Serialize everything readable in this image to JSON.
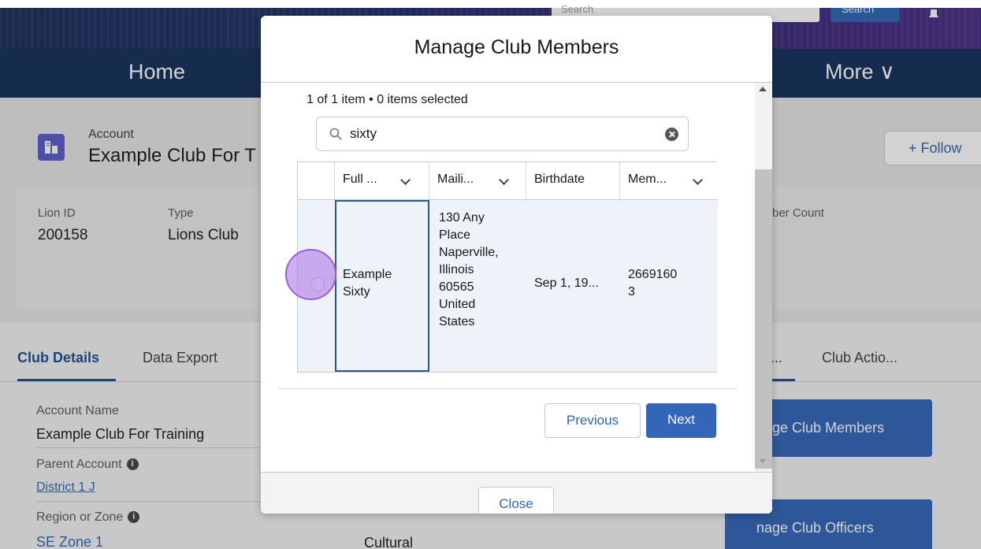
{
  "header": {
    "search_placeholder": "Search",
    "search_button": "Search",
    "nav_home": "Home",
    "nav_more": "More ∨"
  },
  "account": {
    "label": "Account",
    "name": "Example Club For T",
    "follow": "+ Follow",
    "fields": [
      {
        "label": "Lion ID",
        "value": "200158"
      },
      {
        "label": "Type",
        "value": "Lions Club"
      },
      {
        "label": "ber Count",
        "value": ""
      }
    ]
  },
  "tabs": {
    "club_details": "Club Details",
    "data_export": "Data Export",
    "ellipsis": "...",
    "club_actions": "Club Actio..."
  },
  "details": {
    "account_name_label": "Account Name",
    "account_name_value": "Example Club For Training",
    "parent_account_label": "Parent Account",
    "parent_account_value": "District 1 J",
    "region_label": "Region or Zone",
    "region_value": "SE Zone 1",
    "cultural": "Cultural"
  },
  "actions": {
    "manage_members": "nage Club Members",
    "manage_officers": "nage Club Officers"
  },
  "modal": {
    "title": "Manage Club Members",
    "items_count": "1 of 1 item • 0 items selected",
    "search_value": "sixty",
    "columns": [
      "Full ...",
      "Maili...",
      "Birthdate",
      "Mem..."
    ],
    "row": {
      "full_name": "Example Sixty",
      "mailing": [
        "130 Any",
        "Place",
        "Naperville,",
        "Illinois",
        "60565",
        "United",
        "States"
      ],
      "birthdate": "Sep 1, 19...",
      "member_id": [
        "2669160",
        "3"
      ]
    },
    "previous": "Previous",
    "next": "Next",
    "close": "Close"
  },
  "colors": {
    "nav": "#15305c",
    "accent": "#3366b8",
    "link": "#2b67b4"
  }
}
